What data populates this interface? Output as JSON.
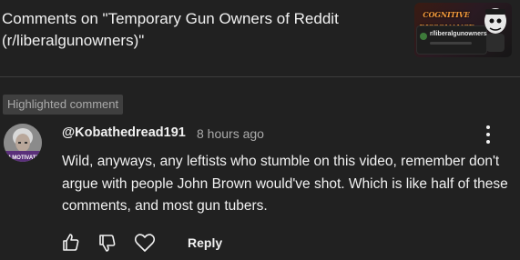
{
  "header": {
    "title": "Comments on \"Temporary Gun Owners of Reddit (r/liberalgunowners)\"",
    "thumbnail": {
      "banner_text": "COGNITIVE DISSONANCE",
      "card_title": "r/liberalgunowners"
    }
  },
  "highlight": {
    "label": "Highlighted comment"
  },
  "comment": {
    "author": "@Kobathedread191",
    "timestamp": "8 hours ago",
    "avatar_text": "M MOTIVATE",
    "text": "Wild, anyways, any leftists who stumble on this video, remember don't argue with people John Brown would've shot. Which is like half of these comments, and most gun tubers.",
    "actions": {
      "like_icon": "thumbs-up-icon",
      "dislike_icon": "thumbs-down-icon",
      "heart_icon": "heart-icon",
      "reply_label": "Reply"
    }
  },
  "colors": {
    "background": "#212121",
    "text_primary": "#f1f1f1",
    "text_secondary": "#aaaaaa",
    "highlight_bg": "#3f3f3f"
  }
}
